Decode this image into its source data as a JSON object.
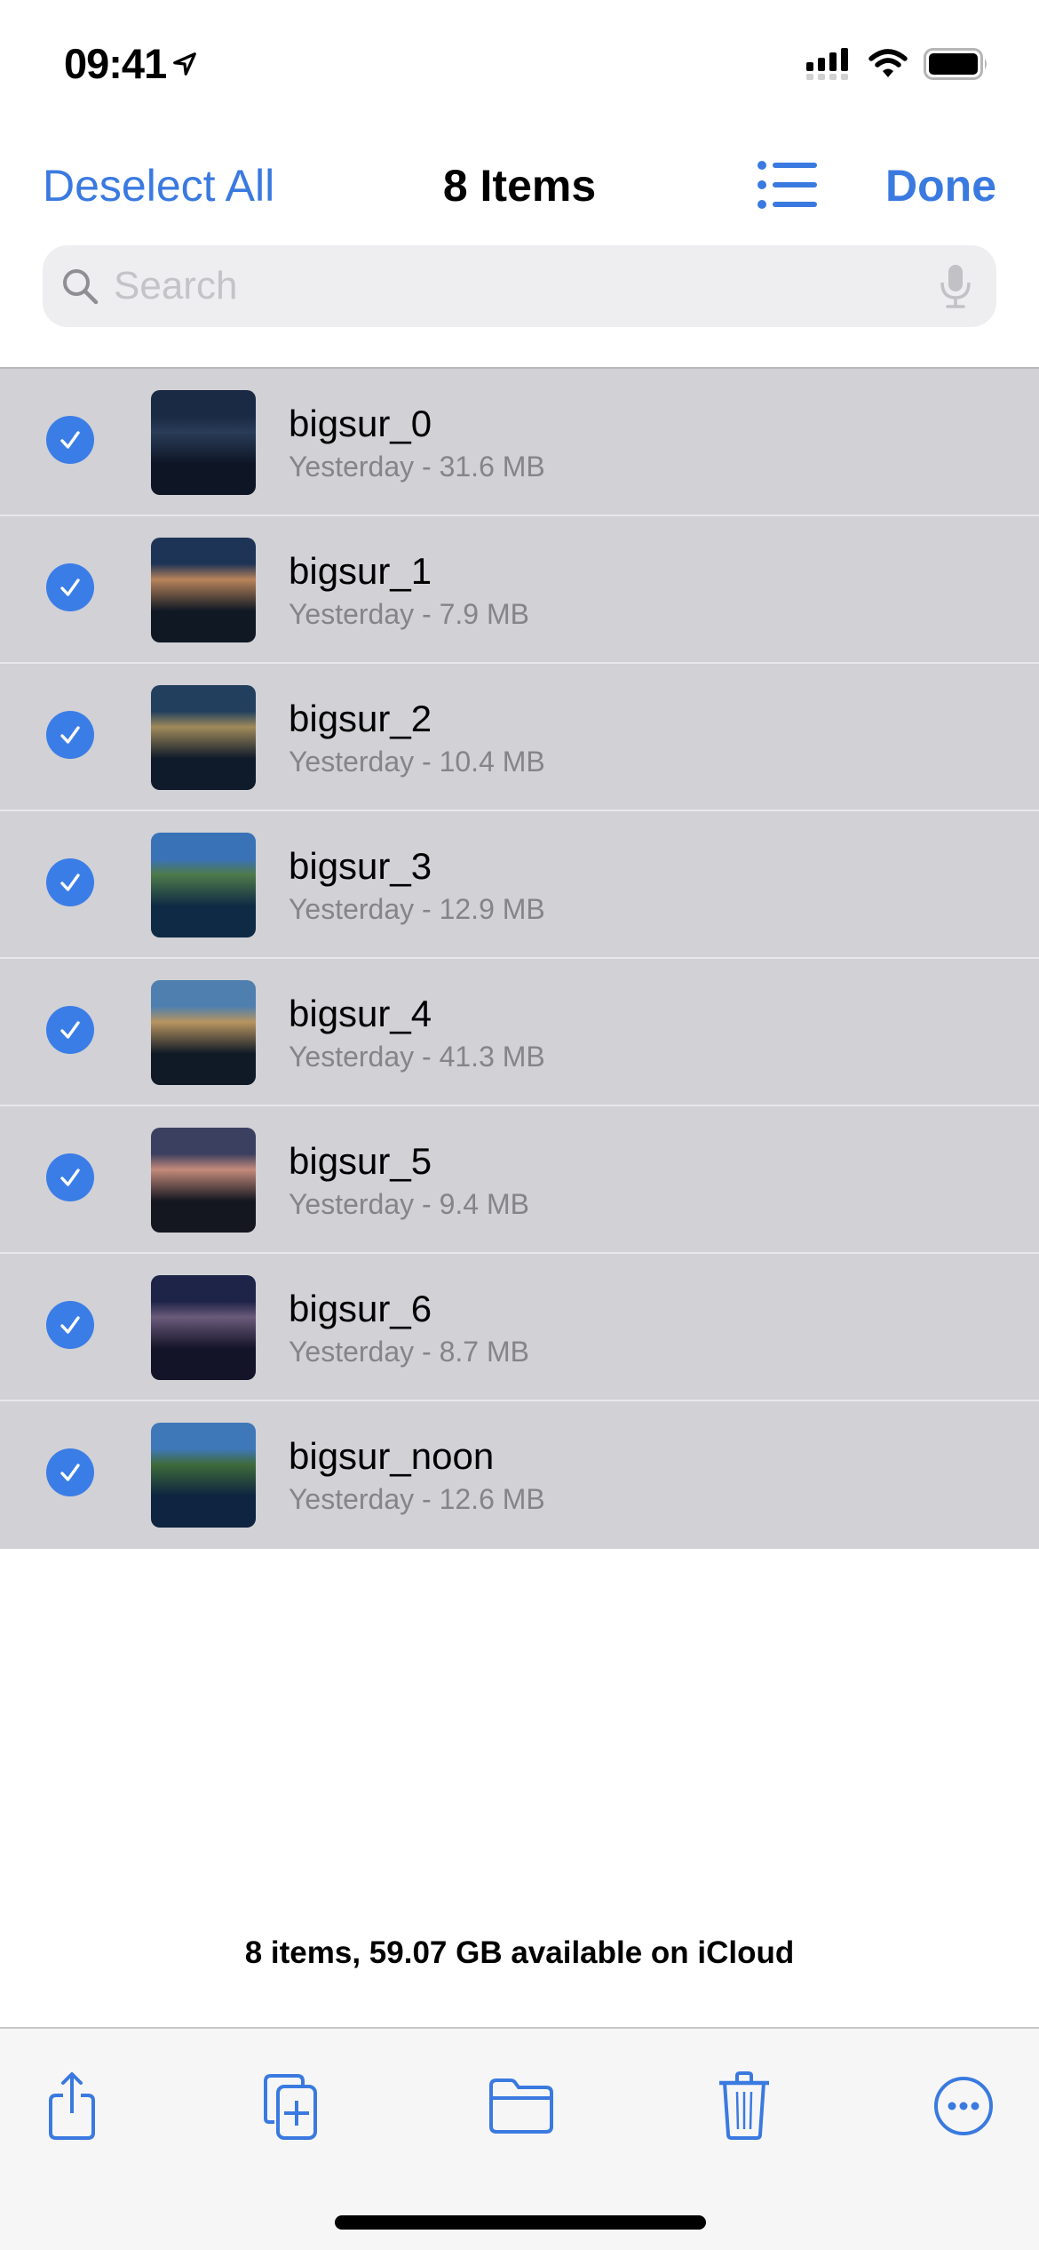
{
  "status_bar": {
    "time": "09:41"
  },
  "nav": {
    "left_button": "Deselect All",
    "title": "8 Items",
    "right_button": "Done",
    "view_toggle_icon": "list-icon"
  },
  "search": {
    "placeholder": "Search",
    "value": ""
  },
  "files": [
    {
      "name": "bigsur_0",
      "meta": "Yesterday - 31.6 MB",
      "selected": true,
      "thumb_colors": [
        "#1a2a44",
        "#2a3c58",
        "#0e1626"
      ]
    },
    {
      "name": "bigsur_1",
      "meta": "Yesterday - 7.9 MB",
      "selected": true,
      "thumb_colors": [
        "#1e3456",
        "#b8835a",
        "#101824"
      ]
    },
    {
      "name": "bigsur_2",
      "meta": "Yesterday - 10.4 MB",
      "selected": true,
      "thumb_colors": [
        "#22405e",
        "#a08a5a",
        "#0f1a2a"
      ]
    },
    {
      "name": "bigsur_3",
      "meta": "Yesterday - 12.9 MB",
      "selected": true,
      "thumb_colors": [
        "#3a72b8",
        "#4e7a4a",
        "#0f2a44"
      ]
    },
    {
      "name": "bigsur_4",
      "meta": "Yesterday - 41.3 MB",
      "selected": true,
      "thumb_colors": [
        "#4f7fae",
        "#b89460",
        "#101a26"
      ]
    },
    {
      "name": "bigsur_5",
      "meta": "Yesterday - 9.4 MB",
      "selected": true,
      "thumb_colors": [
        "#3c4060",
        "#c48a7a",
        "#141620"
      ]
    },
    {
      "name": "bigsur_6",
      "meta": "Yesterday - 8.7 MB",
      "selected": true,
      "thumb_colors": [
        "#1e2448",
        "#6a5a7a",
        "#141428"
      ]
    },
    {
      "name": "bigsur_noon",
      "meta": "Yesterday - 12.6 MB",
      "selected": true,
      "thumb_colors": [
        "#3f78b8",
        "#3e6a3a",
        "#0e2440"
      ]
    }
  ],
  "footer": {
    "info": "8 items, 59.07 GB available on iCloud"
  },
  "toolbar": {
    "items": [
      "share-icon",
      "duplicate-icon",
      "move-folder-icon",
      "trash-icon",
      "more-icon"
    ]
  },
  "colors": {
    "accent": "#3a7ae0",
    "selected_row": "#d1d1d6",
    "check_fill": "#3b7de6"
  }
}
